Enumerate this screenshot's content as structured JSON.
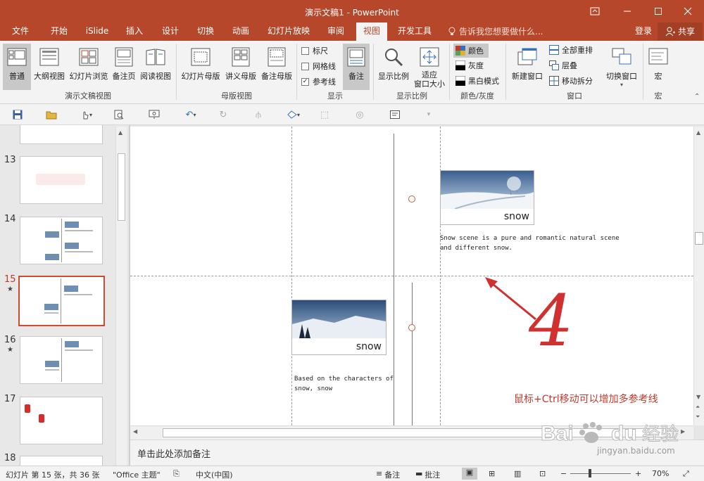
{
  "window": {
    "title": "演示文稿1 - PowerPoint",
    "controls": [
      "restore-ribbon-icon",
      "minimize-icon",
      "maximize-icon",
      "close-icon"
    ]
  },
  "tabs": [
    {
      "label": "文件"
    },
    {
      "label": "开始"
    },
    {
      "label": "iSlide"
    },
    {
      "label": "插入"
    },
    {
      "label": "设计"
    },
    {
      "label": "切换"
    },
    {
      "label": "动画"
    },
    {
      "label": "幻灯片放映"
    },
    {
      "label": "审阅"
    },
    {
      "label": "视图",
      "active": true
    },
    {
      "label": "开发工具"
    }
  ],
  "tell_me": "告诉我您想要做什么...",
  "account": {
    "login": "登录",
    "share": "共享"
  },
  "ribbon": {
    "presentation_views": {
      "group_label": "演示文稿视图",
      "buttons": [
        "普通",
        "大纲视图",
        "幻灯片浏览",
        "备注页",
        "阅读视图"
      ]
    },
    "master_views": {
      "group_label": "母版视图",
      "buttons": [
        "幻灯片母版",
        "讲义母版",
        "备注母版"
      ]
    },
    "show": {
      "group_label": "显示",
      "ruler": {
        "label": "标尺",
        "checked": false
      },
      "gridlines": {
        "label": "网格线",
        "checked": false
      },
      "guides": {
        "label": "参考线",
        "checked": true
      },
      "notes_button": "备注"
    },
    "zoom": {
      "group_label": "显示比例",
      "zoom_button": "显示比例",
      "fit_button": "适应\n窗口大小"
    },
    "color": {
      "group_label": "颜色/灰度",
      "items": [
        "颜色",
        "灰度",
        "黑白模式"
      ],
      "selected": "颜色"
    },
    "window": {
      "group_label": "窗口",
      "new_window": "新建窗口",
      "arrange_all": "全部重排",
      "cascade": "层叠",
      "move_split": "移动拆分"
    },
    "switch": {
      "label": "切换窗口"
    },
    "macros": {
      "group_label": "宏",
      "button": "宏"
    }
  },
  "slides": [
    {
      "number": "13",
      "star": false
    },
    {
      "number": "14",
      "star": false
    },
    {
      "number": "15",
      "star": true,
      "selected": true
    },
    {
      "number": "16",
      "star": true
    },
    {
      "number": "17",
      "star": false
    },
    {
      "number": "18",
      "star": false
    }
  ],
  "slide": {
    "card1_caption": "snow",
    "card1_text_line1": "Snow scene is a pure and romantic natural scene",
    "card1_text_line2": "and different snow.",
    "card2_caption": "snow",
    "card2_text_line1": "Based on the characters of",
    "card2_text_line2": "snow, snow",
    "handwritten_number": "4",
    "annotation": "鼠标+Ctrl移动可以增加多参考线"
  },
  "notes_placeholder": "单击此处添加备注",
  "status": {
    "slide_info": "幻灯片 第 15 张，共 36 张",
    "theme": "\"Office 主题\"",
    "language": "中文(中国)",
    "notes": "备注",
    "comments": "批注",
    "zoom": "70%"
  },
  "watermark": {
    "brand": "Baidu经验",
    "url": "jingyan.baidu.com"
  },
  "colors": {
    "accent": "#b7472a",
    "selection": "#d04a2f",
    "annotation": "#c0392b"
  }
}
